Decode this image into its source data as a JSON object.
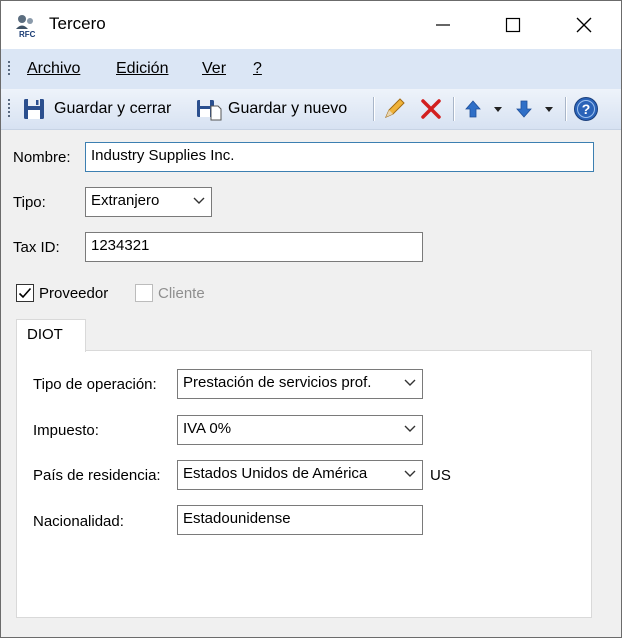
{
  "window": {
    "title": "Tercero"
  },
  "menu": {
    "archivo": "Archivo",
    "edicion": "Edición",
    "ver": "Ver",
    "help": "?"
  },
  "toolbar": {
    "save_close": "Guardar y cerrar",
    "save_new": "Guardar y nuevo"
  },
  "form": {
    "nombre_label": "Nombre:",
    "nombre_value": "Industry Supplies Inc.",
    "tipo_label": "Tipo:",
    "tipo_value": "Extranjero",
    "taxid_label": "Tax ID:",
    "taxid_value": "1234321",
    "proveedor_label": "Proveedor",
    "proveedor_checked": true,
    "cliente_label": "Cliente",
    "cliente_checked": false
  },
  "tabs": [
    {
      "label": "DIOT"
    }
  ],
  "diot": {
    "tipo_operacion_label": "Tipo de operación:",
    "tipo_operacion_value": "Prestación de servicios prof.",
    "impuesto_label": "Impuesto:",
    "impuesto_value": "IVA 0%",
    "pais_label": "País de residencia:",
    "pais_value": "Estados Unidos de América",
    "pais_code": "US",
    "nacionalidad_label": "Nacionalidad:",
    "nacionalidad_value": "Estadounidense"
  },
  "colors": {
    "menubar": "#dbe6f5",
    "toolbar": "#e3ebf6",
    "focus_border": "#3c7fb1",
    "delete_red": "#d21f1f",
    "arrow_blue": "#2f6fc7"
  },
  "icons": [
    "app-icon",
    "minimize-icon",
    "maximize-icon",
    "close-icon",
    "save-close-icon",
    "save-new-icon",
    "edit-pencil-icon",
    "delete-icon",
    "up-arrow-icon",
    "down-arrow-icon",
    "help-icon",
    "checkmark-icon",
    "chevron-down-icon"
  ]
}
